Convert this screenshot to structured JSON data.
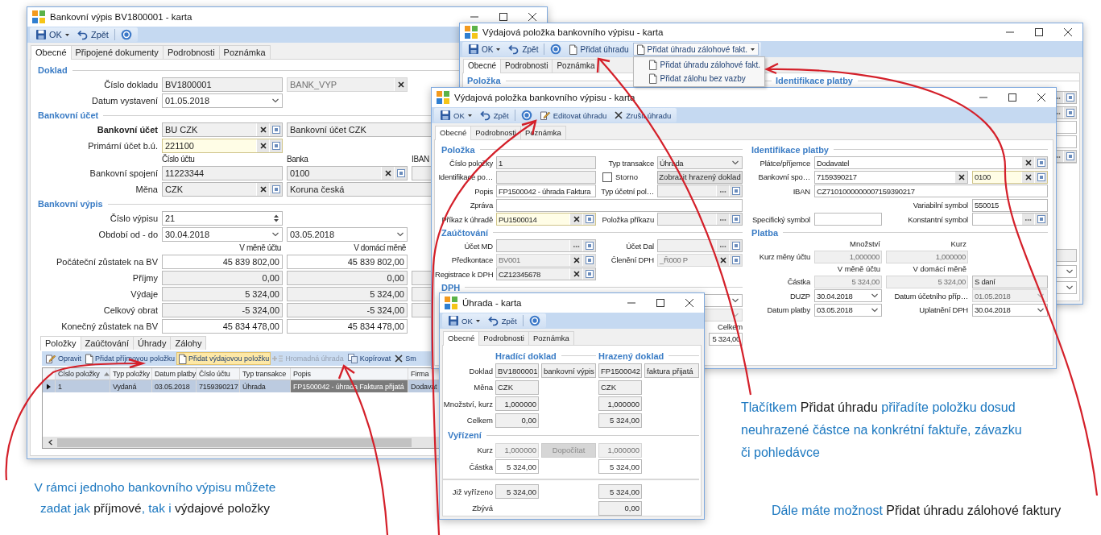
{
  "statement_window": {
    "title": "Bankovní výpis BV1800001 - karta",
    "toolbar": [
      {
        "kind": "save",
        "label": "OK"
      },
      {
        "kind": "undo",
        "label": "Zpět"
      },
      {
        "kind": "help"
      }
    ],
    "tabs": [
      {
        "label": "Obecné",
        "selected": true
      },
      {
        "label": "Připojené dokumenty",
        "selected": false
      },
      {
        "label": "Podrobnosti",
        "selected": false
      },
      {
        "label": "Poznámka",
        "selected": false
      }
    ],
    "form": [
      [
        {
          "kind": "heading",
          "text": "Doklad"
        }
      ],
      [
        {
          "kind": "label",
          "text": "Číslo dokladu"
        },
        {
          "kind": "field",
          "value": "BV1800001",
          "readonly": true,
          "disabled": false,
          "required": false
        },
        {
          "kind": "clearfield",
          "value": "BANK_VYP",
          "readonly": true,
          "disabled": true,
          "required": false
        }
      ],
      [
        {
          "kind": "label",
          "text": "Datum vystavení"
        },
        {
          "kind": "combo",
          "value": "01.05.2018",
          "readonly": false,
          "disabled": false,
          "required": false
        }
      ],
      [
        {
          "kind": "heading",
          "text": "Bankovní účet"
        }
      ],
      [
        {
          "kind": "label",
          "text": "Bankovní účet",
          "bold": true
        },
        {
          "kind": "lookup",
          "value": "BU CZK",
          "readonly": true,
          "disabled": false,
          "required": false
        },
        {
          "kind": "field",
          "value": "Bankovní účet CZK",
          "readonly": true,
          "disabled": false,
          "required": false
        }
      ],
      [
        {
          "kind": "label",
          "text": "Primární účet b.ú.",
          "bold": false
        },
        {
          "kind": "lookup",
          "value": "221100",
          "readonly": false,
          "disabled": false,
          "required": true
        }
      ],
      [
        {
          "kind": "caption",
          "text": "Číslo účtu"
        },
        {
          "kind": "caption",
          "text": "Banka"
        },
        {
          "kind": "caption",
          "text": "IBAN"
        }
      ],
      [
        {
          "kind": "label",
          "text": "Bankovní spojení"
        },
        {
          "kind": "field",
          "value": "11223344",
          "readonly": true,
          "disabled": false,
          "required": false
        },
        {
          "kind": "lookup",
          "value": "0100",
          "readonly": true,
          "disabled": false,
          "required": false
        },
        {
          "kind": "field",
          "readonly": true,
          "disabled": false,
          "required": false
        }
      ],
      [
        {
          "kind": "label",
          "text": "Měna"
        },
        {
          "kind": "lookup",
          "value": "CZK",
          "readonly": true,
          "disabled": false,
          "required": false
        },
        {
          "kind": "field",
          "value": "Koruna česká",
          "readonly": true,
          "disabled": false,
          "required": false
        }
      ],
      [
        {
          "kind": "heading",
          "text": "Bankovní výpis"
        }
      ],
      [
        {
          "kind": "label",
          "text": "Číslo výpisu"
        },
        {
          "kind": "spinner",
          "value": "21",
          "readonly": false,
          "disabled": false,
          "required": false
        }
      ],
      [
        {
          "kind": "label",
          "text": "Období od - do"
        },
        {
          "kind": "combo",
          "value": "30.04.2018",
          "readonly": false,
          "disabled": false,
          "required": false
        },
        {
          "kind": "combo",
          "value": "03.05.2018",
          "readonly": false,
          "disabled": false,
          "required": false
        }
      ],
      [
        {
          "kind": "valuecaption",
          "text": "V měně účtu"
        },
        {
          "kind": "valuecaption",
          "text": "V domácí měně"
        }
      ],
      [
        {
          "kind": "label",
          "text": "Počáteční zůstatek na BV"
        },
        {
          "kind": "amount",
          "value": "45 839 802,00",
          "readonly": false,
          "disabled": false,
          "required": false
        },
        {
          "kind": "amount",
          "value": "45 839 802,00",
          "readonly": false,
          "disabled": false,
          "required": false
        }
      ],
      [
        {
          "kind": "label",
          "text": "Příjmy"
        },
        {
          "kind": "amount",
          "value": "0,00",
          "readonly": true,
          "disabled": false,
          "required": false
        },
        {
          "kind": "amount",
          "value": "0,00",
          "readonly": true,
          "disabled": false,
          "required": false
        },
        {
          "kind": "field",
          "readonly": true,
          "disabled": false,
          "required": false
        }
      ],
      [
        {
          "kind": "label",
          "text": "Výdaje"
        },
        {
          "kind": "amount",
          "value": "5 324,00",
          "readonly": true,
          "disabled": false,
          "required": false
        },
        {
          "kind": "amount",
          "value": "5 324,00",
          "readonly": true,
          "disabled": false,
          "required": false
        },
        {
          "kind": "field",
          "readonly": true,
          "disabled": false,
          "required": false
        }
      ],
      [
        {
          "kind": "label",
          "text": "Celkový obrat"
        },
        {
          "kind": "amount",
          "value": "-5 324,00",
          "readonly": true,
          "disabled": false,
          "required": false
        },
        {
          "kind": "amount",
          "value": "-5 324,00",
          "readonly": true,
          "disabled": false,
          "required": false
        },
        {
          "kind": "field",
          "readonly": true,
          "disabled": false,
          "required": false
        }
      ],
      [
        {
          "kind": "label",
          "text": "Konečný zůstatek na BV"
        },
        {
          "kind": "amount",
          "value": "45 834 478,00",
          "readonly": false,
          "disabled": false,
          "required": false
        },
        {
          "kind": "amount",
          "value": "45 834 478,00",
          "readonly": false,
          "disabled": false,
          "required": false
        }
      ]
    ],
    "detail_tabs": [
      {
        "label": "Položky",
        "selected": true
      },
      {
        "label": "Zaúčtování",
        "selected": false
      },
      {
        "label": "Úhrady",
        "selected": false
      },
      {
        "label": "Zálohy",
        "selected": false
      }
    ],
    "detail_toolbar": [
      {
        "kind": "edit",
        "label": "Opravit",
        "disabled": false,
        "highlighted": false
      },
      {
        "kind": "add",
        "label": "Přidat příjmovou položku",
        "disabled": false,
        "highlighted": false
      },
      {
        "kind": "add",
        "label": "Přidat výdajovou položku",
        "disabled": false,
        "highlighted": true
      },
      {
        "kind": "bulk",
        "label": "Hromadná úhrada",
        "disabled": true,
        "highlighted": false
      },
      {
        "kind": "copy",
        "label": "Kopírovat",
        "disabled": false,
        "highlighted": false
      },
      {
        "kind": "delete",
        "label": "Sm",
        "disabled": false,
        "highlighted": false
      }
    ],
    "table": {
      "columns": [
        {
          "label": "Číslo položky",
          "sorted": true
        },
        {
          "label": "Typ položky",
          "sorted": false
        },
        {
          "label": "Datum platby",
          "sorted": false
        },
        {
          "label": "Číslo účtu",
          "sorted": false
        },
        {
          "label": "Typ transakce",
          "sorted": false
        },
        {
          "label": "Popis",
          "sorted": false
        },
        {
          "label": "Firma",
          "sorted": false
        }
      ],
      "rows": [
        {
          "selected": true,
          "cells": [
            {
              "text": "1",
              "focused": false
            },
            {
              "text": "Vydaná",
              "focused": false
            },
            {
              "text": "03.05.2018",
              "focused": false
            },
            {
              "text": "7159390217",
              "focused": false
            },
            {
              "text": "Úhrada",
              "focused": false
            },
            {
              "text": "FP1500042 - úhrada Faktura přijatá",
              "focused": true
            },
            {
              "text": "Dodavat",
              "focused": false
            }
          ]
        }
      ]
    }
  },
  "payment_item_window_back": {
    "title": "Výdajová položka bankovního výpisu - karta",
    "toolbar": [
      {
        "kind": "save",
        "label": "OK"
      },
      {
        "kind": "undo",
        "label": "Zpět"
      },
      {
        "kind": "help"
      },
      {
        "kind": "add",
        "label": "Přidat úhradu"
      },
      {
        "kind": "menu",
        "label": "Přidat úhradu zálohové fakt.",
        "open": true,
        "items": [
          {
            "label": "Přidat úhradu zálohové fakt."
          },
          {
            "label": "Přidat zálohu bez vazby"
          }
        ]
      }
    ],
    "tabs": [
      {
        "label": "Obecné",
        "selected": true
      },
      {
        "label": "Podrobnosti",
        "selected": false
      },
      {
        "label": "Poznámka",
        "selected": false
      }
    ],
    "headings": [
      "Položka",
      "Identifikace platby"
    ]
  },
  "payment_item_window": {
    "title": "Výdajová položka bankovního výpisu - karta",
    "toolbar": [
      {
        "kind": "save",
        "label": "OK"
      },
      {
        "kind": "undo",
        "label": "Zpět"
      },
      {
        "kind": "help"
      },
      {
        "kind": "edit",
        "label": "Editovat úhradu"
      },
      {
        "kind": "cancel",
        "label": "Zrušit úhradu"
      }
    ],
    "tabs": [
      {
        "label": "Obecné",
        "selected": true
      },
      {
        "label": "Podrobnosti",
        "selected": false
      },
      {
        "label": "Poznámka",
        "selected": false
      }
    ],
    "left_form": [
      [
        {
          "kind": "heading",
          "text": "Položka"
        }
      ],
      [
        {
          "kind": "label",
          "text": "Číslo položky"
        },
        {
          "kind": "field",
          "value": "1",
          "readonly": true,
          "disabled": false,
          "required": false
        },
        {
          "kind": "label",
          "text": "Typ transakce"
        },
        {
          "kind": "combo",
          "value": "Úhrada",
          "readonly": true,
          "disabled": false,
          "required": false
        }
      ],
      [
        {
          "kind": "label",
          "text": "Identifikace po…"
        },
        {
          "kind": "field",
          "readonly": true,
          "disabled": false,
          "required": false
        },
        {
          "kind": "checkbox",
          "text": "Storno",
          "checked": false
        },
        {
          "kind": "button",
          "text": "Zobrazit hrazený doklad",
          "disabled": false
        }
      ],
      [
        {
          "kind": "label",
          "text": "Popis"
        },
        {
          "kind": "field",
          "value": "FP1500042 - úhrada Faktura",
          "readonly": false,
          "disabled": false,
          "required": false
        },
        {
          "kind": "label",
          "text": "Typ účetní pol…"
        },
        {
          "kind": "picker",
          "readonly": true,
          "disabled": false,
          "required": false
        }
      ],
      [
        {
          "kind": "label",
          "text": "Zpráva"
        },
        {
          "kind": "field",
          "readonly": false,
          "disabled": false,
          "required": false
        }
      ],
      [
        {
          "kind": "label",
          "text": "Příkaz k úhradě"
        },
        {
          "kind": "lookup",
          "value": "PU1500014",
          "readonly": false,
          "disabled": false,
          "required": true
        },
        {
          "kind": "label",
          "text": "Položka příkazu"
        },
        {
          "kind": "picker",
          "readonly": true,
          "disabled": false,
          "required": false
        }
      ],
      [
        {
          "kind": "heading",
          "text": "Zaúčtování"
        }
      ],
      [
        {
          "kind": "label",
          "text": "Účet MD"
        },
        {
          "kind": "picker",
          "readonly": true,
          "disabled": false,
          "required": false
        },
        {
          "kind": "label",
          "text": "Účet Dal"
        },
        {
          "kind": "picker",
          "readonly": true,
          "disabled": false,
          "required": false
        }
      ],
      [
        {
          "kind": "label",
          "text": "Předkontace"
        },
        {
          "kind": "lookup",
          "value": "BV001",
          "readonly": true,
          "disabled": true,
          "required": false
        },
        {
          "kind": "label",
          "text": "Členění DPH"
        },
        {
          "kind": "lookup",
          "value": "_Ř000 P",
          "readonly": true,
          "disabled": true,
          "required": false
        }
      ],
      [
        {
          "kind": "label",
          "text": "Registrace k DPH"
        },
        {
          "kind": "lookup",
          "value": "CZ12345678",
          "readonly": true,
          "disabled": false,
          "required": false
        }
      ],
      [
        {
          "kind": "heading",
          "text": "DPH"
        }
      ],
      [
        {
          "kind": "combo",
          "readonly": false,
          "disabled": false,
          "required": false
        }
      ],
      [
        {
          "kind": "combo",
          "readonly": true,
          "disabled": true,
          "required": false
        }
      ],
      [
        {
          "kind": "label",
          "text": "Celkem"
        }
      ],
      [
        {
          "kind": "amount",
          "value": "5 324,00",
          "readonly": false,
          "disabled": false,
          "required": false
        }
      ]
    ],
    "right_form": [
      [
        {
          "kind": "heading",
          "text": "Identifikace platby"
        }
      ],
      [
        {
          "kind": "label",
          "text": "Plátce/příjemce"
        },
        {
          "kind": "lookup",
          "value": "Dodavatel",
          "readonly": false,
          "disabled": false,
          "required": false
        }
      ],
      [
        {
          "kind": "label",
          "text": "Bankovní spo…"
        },
        {
          "kind": "clearfield",
          "value": "7159390217",
          "readonly": false,
          "disabled": false,
          "required": false
        },
        {
          "kind": "lookup",
          "value": "0100",
          "readonly": false,
          "disabled": false,
          "required": true
        }
      ],
      [
        {
          "kind": "label",
          "text": "IBAN"
        },
        {
          "kind": "field",
          "value": "CZ7101000000007159390217",
          "readonly": false,
          "disabled": false,
          "required": false
        }
      ],
      [
        {
          "kind": "label",
          "text": "Variabilní symbol"
        },
        {
          "kind": "field",
          "value": "550015",
          "readonly": false,
          "disabled": false,
          "required": false
        }
      ],
      [
        {
          "kind": "label",
          "text": "Specifický symbol"
        },
        {
          "kind": "field",
          "readonly": false,
          "disabled": false,
          "required": false
        },
        {
          "kind": "label",
          "text": "Konstantní symbol"
        },
        {
          "kind": "picker",
          "readonly": false,
          "disabled": false,
          "required": false
        }
      ],
      [
        {
          "kind": "heading",
          "text": "Platba"
        }
      ],
      [
        {
          "kind": "valuecaption",
          "text": "Množství"
        },
        {
          "kind": "valuecaption",
          "text": "Kurz"
        }
      ],
      [
        {
          "kind": "label",
          "text": "Kurz měny účtu"
        },
        {
          "kind": "amount",
          "value": "1,000000",
          "readonly": true,
          "disabled": true,
          "required": false
        },
        {
          "kind": "amount",
          "value": "1,000000",
          "readonly": true,
          "disabled": true,
          "required": false
        }
      ],
      [
        {
          "kind": "valuecaption",
          "text": "V měně účtu"
        },
        {
          "kind": "valuecaption",
          "text": "V domácí měně"
        }
      ],
      [
        {
          "kind": "label",
          "text": "Částka"
        },
        {
          "kind": "amount",
          "value": "5 324,00",
          "readonly": true,
          "disabled": true,
          "required": false
        },
        {
          "kind": "amount",
          "value": "5 324,00",
          "readonly": true,
          "disabled": true,
          "required": false
        },
        {
          "kind": "field",
          "value": "S daní",
          "readonly": true,
          "disabled": false,
          "required": false
        }
      ],
      [
        {
          "kind": "label",
          "text": "DUZP"
        },
        {
          "kind": "combo",
          "value": "30.04.2018",
          "readonly": false,
          "disabled": false,
          "required": false
        },
        {
          "kind": "label",
          "text": "Datum účetního příp…"
        },
        {
          "kind": "combo",
          "value": "01.05.2018",
          "readonly": true,
          "disabled": true,
          "required": false
        }
      ],
      [
        {
          "kind": "label",
          "text": "Datum platby"
        },
        {
          "kind": "combo",
          "value": "03.05.2018",
          "readonly": false,
          "disabled": false,
          "required": false
        },
        {
          "kind": "label",
          "text": "Uplatnění DPH"
        },
        {
          "kind": "combo",
          "value": "30.04.2018",
          "readonly": false,
          "disabled": false,
          "required": false
        }
      ]
    ]
  },
  "payment_window": {
    "title": "Úhrada - karta",
    "toolbar": [
      {
        "kind": "save",
        "label": "OK"
      },
      {
        "kind": "undo",
        "label": "Zpět"
      },
      {
        "kind": "help"
      }
    ],
    "tabs": [
      {
        "label": "Obecné",
        "selected": true
      },
      {
        "label": "Podrobnosti",
        "selected": false
      },
      {
        "label": "Poznámka",
        "selected": false
      }
    ],
    "form": [
      [
        {
          "kind": "heading",
          "text": "Hradící doklad"
        },
        {
          "kind": "heading",
          "text": "Hrazený doklad"
        }
      ],
      [
        {
          "kind": "label",
          "text": "Doklad"
        },
        {
          "kind": "field",
          "value": "BV1800001",
          "readonly": true,
          "disabled": false,
          "required": false
        },
        {
          "kind": "field",
          "value": "bankovní výpis",
          "readonly": true,
          "disabled": false,
          "required": false
        },
        {
          "kind": "field",
          "value": "FP1500042",
          "readonly": true,
          "disabled": false,
          "required": false
        },
        {
          "kind": "field",
          "value": "faktura přijatá",
          "readonly": true,
          "disabled": false,
          "required": false
        }
      ],
      [
        {
          "kind": "label",
          "text": "Měna"
        },
        {
          "kind": "field",
          "value": "CZK",
          "readonly": true,
          "disabled": false,
          "required": false
        },
        {
          "kind": "field",
          "value": "CZK",
          "readonly": true,
          "disabled": false,
          "required": false
        }
      ],
      [
        {
          "kind": "label",
          "text": "Množství, kurz"
        },
        {
          "kind": "amount",
          "value": "1,000000",
          "readonly": true,
          "disabled": false,
          "required": false
        },
        {
          "kind": "amount",
          "value": "1,000000",
          "readonly": true,
          "disabled": false,
          "required": false
        }
      ],
      [
        {
          "kind": "label",
          "text": "Celkem"
        },
        {
          "kind": "amount",
          "value": "0,00",
          "readonly": true,
          "disabled": false,
          "required": false
        },
        {
          "kind": "amount",
          "value": "5 324,00",
          "readonly": true,
          "disabled": false,
          "required": false
        }
      ],
      [
        {
          "kind": "heading",
          "text": "Vyřízení"
        }
      ],
      [
        {
          "kind": "label",
          "text": "Kurz"
        },
        {
          "kind": "amount",
          "value": "1,000000",
          "readonly": true,
          "disabled": true,
          "required": false
        },
        {
          "kind": "button",
          "text": "Dopočítat",
          "disabled": true
        },
        {
          "kind": "amount",
          "value": "1,000000",
          "readonly": true,
          "disabled": true,
          "required": false
        }
      ],
      [
        {
          "kind": "label",
          "text": "Částka"
        },
        {
          "kind": "amount",
          "value": "5 324,00",
          "readonly": false,
          "disabled": false,
          "required": false
        },
        {
          "kind": "amount",
          "value": "5 324,00",
          "readonly": false,
          "disabled": false,
          "required": false
        }
      ],
      [
        {
          "kind": "separator"
        }
      ],
      [
        {
          "kind": "label",
          "text": "Již vyřízeno"
        },
        {
          "kind": "amount",
          "value": "5 324,00",
          "readonly": true,
          "disabled": false,
          "required": false
        },
        {
          "kind": "amount",
          "value": "5 324,00",
          "readonly": true,
          "disabled": false,
          "required": false
        }
      ],
      [
        {
          "kind": "label",
          "text": "Zbývá"
        },
        {
          "kind": "amount",
          "value": "0,00",
          "readonly": true,
          "disabled": false,
          "required": false
        }
      ]
    ]
  },
  "annotations": [
    {
      "lines": [
        [
          {
            "text": "V rámci jednoho bankovního výpisu můžete",
            "kind": "note"
          }
        ],
        [
          {
            "text": "zadat jak ",
            "kind": "note"
          },
          {
            "text": "příjmové",
            "kind": "term"
          },
          {
            "text": ", tak i ",
            "kind": "note"
          },
          {
            "text": "výdajové položky",
            "kind": "term"
          }
        ]
      ]
    },
    {
      "lines": [
        [
          {
            "text": "Tlačítkem ",
            "kind": "note"
          },
          {
            "text": "Přidat úhradu",
            "kind": "term"
          },
          {
            "text": " přiřadíte položku dosud",
            "kind": "note"
          }
        ],
        [
          {
            "text": "neuhrazené částce na konkrétní faktuře, závazku",
            "kind": "note"
          }
        ],
        [
          {
            "text": "či pohledávce",
            "kind": "note"
          }
        ]
      ]
    },
    {
      "lines": [
        [
          {
            "text": "Dále máte možnost ",
            "kind": "note"
          },
          {
            "text": "Přidat úhradu zálohové faktury",
            "kind": "term"
          }
        ]
      ]
    }
  ]
}
